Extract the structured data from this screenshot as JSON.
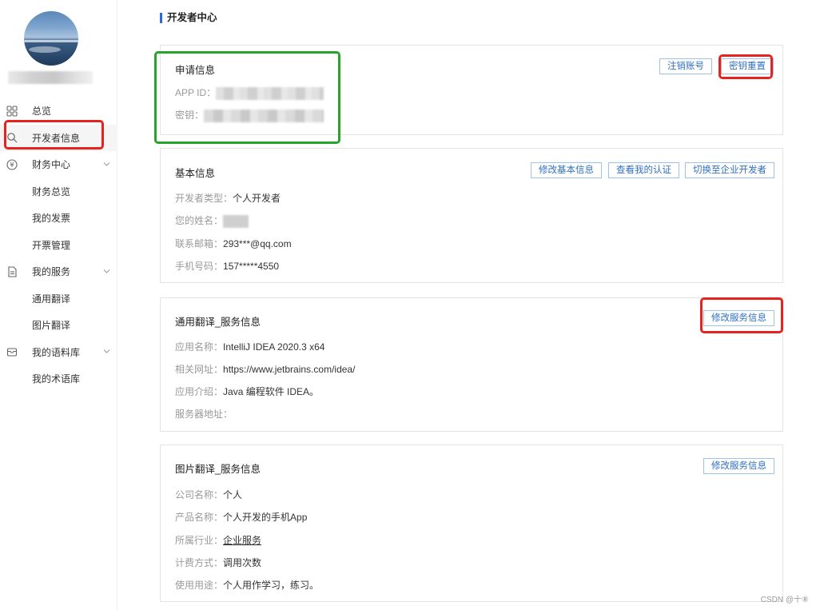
{
  "sidebar": {
    "items": [
      {
        "label": "总览",
        "icon": "grid-icon"
      },
      {
        "label": "开发者信息",
        "icon": "search-icon"
      },
      {
        "label": "财务中心",
        "icon": "yen-icon"
      },
      {
        "label": "财务总览"
      },
      {
        "label": "我的发票"
      },
      {
        "label": "开票管理"
      },
      {
        "label": "我的服务",
        "icon": "document-icon"
      },
      {
        "label": "通用翻译"
      },
      {
        "label": "图片翻译"
      },
      {
        "label": "我的语料库",
        "icon": "box-icon"
      },
      {
        "label": "我的术语库"
      }
    ]
  },
  "header": {
    "title": "开发者中心"
  },
  "apply": {
    "title": "申请信息",
    "app_id_label": "APP ID：",
    "secret_label": "密钥：",
    "cancel_account_btn": "注销账号",
    "reset_secret_btn": "密钥重置"
  },
  "basic": {
    "title": "基本信息",
    "btn_modify": "修改基本信息",
    "btn_view_cert": "查看我的认证",
    "btn_switch": "切换至企业开发者",
    "type_label": "开发者类型：",
    "type_value": "个人开发者",
    "name_label": "您的姓名：",
    "email_label": "联系邮箱：",
    "email_value": "293***@qq.com",
    "phone_label": "手机号码：",
    "phone_value": "157*****4550"
  },
  "general": {
    "title": "通用翻译_服务信息",
    "btn_modify": "修改服务信息",
    "app_name_label": "应用名称：",
    "app_name_value": "IntelliJ IDEA 2020.3 x64",
    "url_label": "相关网址：",
    "url_value": "https://www.jetbrains.com/idea/",
    "intro_label": "应用介绍：",
    "intro_value": "Java 编程软件 IDEA。",
    "server_label": "服务器地址：",
    "server_value": ""
  },
  "image": {
    "title": "图片翻译_服务信息",
    "btn_modify": "修改服务信息",
    "company_label": "公司名称：",
    "company_value": "个人",
    "product_label": "产品名称：",
    "product_value": "个人开发的手机App",
    "industry_label": "所属行业：",
    "industry_value": "企业服务",
    "billing_label": "计费方式：",
    "billing_value": "调用次数",
    "usage_label": "使用用途：",
    "usage_value": "个人用作学习，练习。"
  },
  "watermark": "CSDN @十⑧",
  "colors": {
    "accent": "#2b6ad8",
    "highlight_red": "#e8231f",
    "highlight_green": "#27a52a"
  }
}
